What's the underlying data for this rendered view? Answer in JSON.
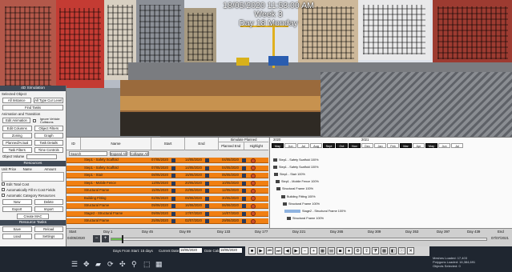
{
  "hud": {
    "date": "18/05/2020 11:53:00 AM",
    "week": "Week 3",
    "day": "Day 18 Monday"
  },
  "panel": {
    "title": "4D Simulation",
    "selected_object_label": "Selected Object",
    "all_instance": "All Instance",
    "all_type": "All Type Cur Level",
    "find_tasks": "Find Tasks",
    "animation_label": "Animation and Transition",
    "edit_animation": "Edit Animation",
    "ignore_vehicle": "Ignore Vehicle Collisions",
    "edit_columns": "Edit Columns",
    "object_filters": "Object Filters",
    "zoning": "Zoning",
    "graph": "Graph",
    "planned_actual": "Planned/Actual",
    "task_details": "Task Details",
    "task_filters": "Task Filters",
    "time_controls": "Time Controls",
    "object_volume": "Object Volume",
    "resources_header": "Resources",
    "unit_price": "Unit Price",
    "name": "Name",
    "amount": "Amount",
    "edit_total_cost": "Edit Total Cost",
    "auto_fill": "Automatically Fill In Cost Fields",
    "auto_category": "Automatic Category Resources",
    "new": "New",
    "delete": "Delete",
    "export": "Export",
    "import": "Import",
    "create_mac": "Create MAC",
    "resource_tasks_header": "Resource Tasks",
    "save": "Save",
    "reload": "Reload",
    "load": "Load",
    "settings": "Settings"
  },
  "schedule": {
    "headers": {
      "id": "ID",
      "name": "Name",
      "start": "Start",
      "end": "End"
    },
    "simulate_planned": "Simulate Planned",
    "planned_end": "Planned End",
    "highlight": "Highlight",
    "search_placeholder": "Search",
    "expand_all": "Expand All",
    "collapse_all": "Collapse All",
    "tasks": [
      {
        "name": "Step1 - Safety Scaffold",
        "start": "07/05/2020",
        "end": "14/05/2020",
        "planned": "04/05/2020"
      },
      {
        "name": "Step1 - Safety Scaffold",
        "start": "07/05/2020",
        "end": "14/05/2020",
        "planned": "04/05/2020"
      },
      {
        "name": "Step1 - Stair",
        "start": "08/05/2020",
        "end": "15/05/2020",
        "planned": "05/05/2020"
      },
      {
        "name": "Step1 - Mobile Fence",
        "start": "13/05/2020",
        "end": "20/05/2020",
        "planned": "10/05/2020"
      },
      {
        "name": "Structural Frame",
        "start": "15/05/2020",
        "end": "22/05/2020",
        "planned": "12/05/2020"
      },
      {
        "name": "Building Fitting",
        "start": "02/06/2020",
        "end": "09/06/2020",
        "planned": "30/05/2020"
      },
      {
        "name": "Structural Frame",
        "start": "09/06/2020",
        "end": "16/06/2020",
        "planned": "06/06/2020"
      },
      {
        "name": "Stage2 - Structural Frame",
        "start": "09/06/2020",
        "end": "17/07/2020",
        "planned": "14/07/2020"
      },
      {
        "name": "Structural Frame",
        "start": "25/06/2020",
        "end": "02/07/2020",
        "planned": "29/06/2020"
      }
    ]
  },
  "gantt": {
    "years": [
      "2020",
      "2021"
    ],
    "months": [
      "May",
      "Jun",
      "Jul",
      "Aug",
      "Sept",
      "Oct",
      "Nov",
      "Dec",
      "Jan",
      "Feb",
      "Mar",
      "Apr",
      "May",
      "Jun",
      "Jul"
    ],
    "dark_months": [
      0,
      4,
      5,
      6,
      10,
      12
    ],
    "labels": [
      "Step1 - Safety Scaffold  100%",
      "Step1 - Safety Scaffold  100%",
      "Step1 - Stair  100%",
      "Step1 - Mobile Fence  100%",
      "Structural Frame  100%",
      "Building Fitting  100%",
      "Structural Frame  100%",
      "Stage2 - Structural Frame  100%",
      "Structural Frame  100%"
    ]
  },
  "timeline": {
    "start_label": "Start",
    "start_date": "04/05/2020",
    "end_label": "End",
    "end_date": "07/07/2021",
    "days": [
      "Day 1",
      "Day 45",
      "Day 89",
      "Day 133",
      "Day 177",
      "Day 221",
      "Day 265",
      "Day 309",
      "Day 353",
      "Day 397",
      "Day 439"
    ],
    "days_from_start": "Days From Start: 15 days",
    "current_date_label": "Current Date:",
    "current_date": "18/05/2020",
    "date_calc_label": "Date Calc:",
    "date_calc": "18/05/2020"
  },
  "status": {
    "line1": "Meshes Loaded: 17,403",
    "line2": "Polygons Loaded: 16,384,691",
    "line3": "Objects Selected: 0"
  },
  "colors": {
    "task_orange": "#f07f12",
    "panel_header": "#404a57",
    "bottom_bar": "#1f2630"
  }
}
